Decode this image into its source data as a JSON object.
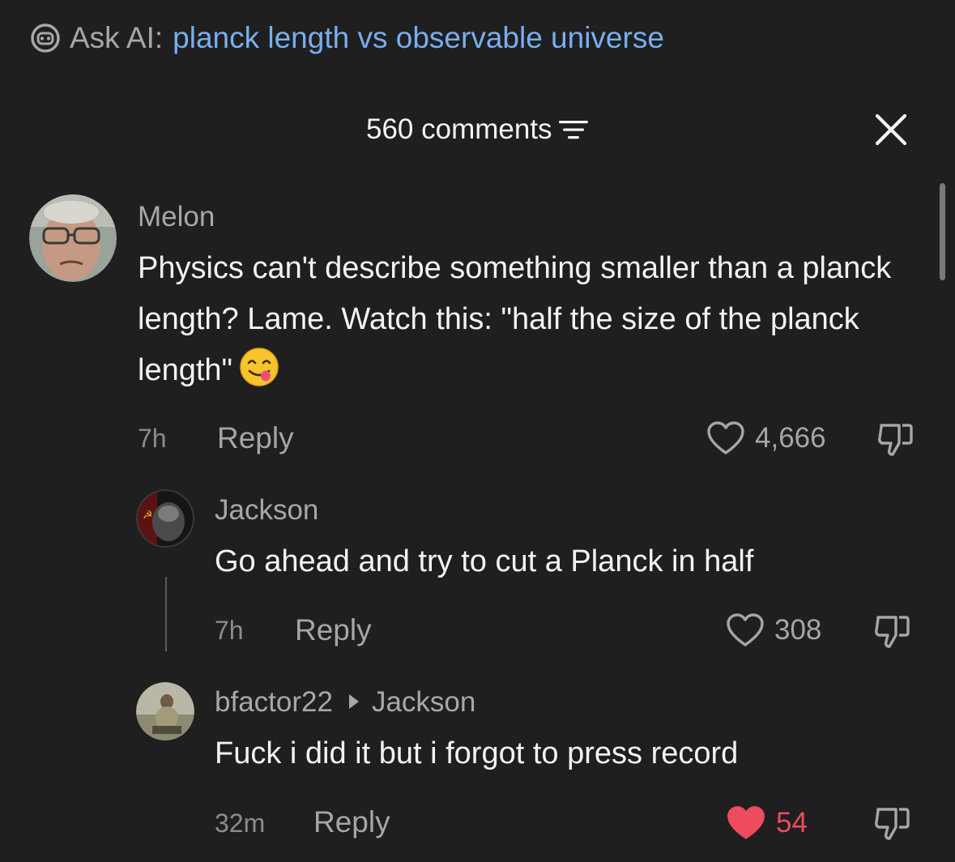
{
  "ask_ai": {
    "prefix": "Ask AI:",
    "query": "planck length vs observable universe",
    "icon": "robot-face-icon"
  },
  "header": {
    "comment_count": "560 comments",
    "sort_icon": "filter-lines-icon",
    "close_icon": "close-icon"
  },
  "comments": [
    {
      "username": "Melon",
      "text": "Physics can't describe something smaller than a planck length? Lame. Watch this: \"half the size of the planck length\"",
      "emoji": "face-savoring-food",
      "time": "7h",
      "reply_label": "Reply",
      "likes": "4,666",
      "liked": false
    },
    {
      "username": "Jackson",
      "text": "Go ahead and try to cut a Planck in half",
      "time": "7h",
      "reply_label": "Reply",
      "likes": "308",
      "liked": false
    },
    {
      "username": "bfactor22",
      "reply_to": "Jackson",
      "text": "Fuck i did it but i forgot to press record",
      "time": "32m",
      "reply_label": "Reply",
      "likes": "54",
      "liked": true
    }
  ],
  "colors": {
    "background": "#1f1f1f",
    "link_blue": "#78aef0",
    "like_red": "#ee4b5f",
    "muted": "#a6a6a6"
  }
}
